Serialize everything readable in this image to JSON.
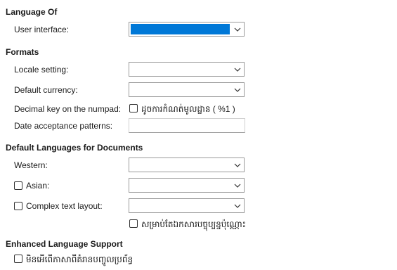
{
  "sections": {
    "language_of": "Language Of",
    "formats": "Formats",
    "default_languages": "Default Languages for Documents",
    "enhanced_support": "Enhanced Language Support"
  },
  "language_of": {
    "user_interface_label": "User interface:",
    "user_interface_value": ""
  },
  "formats": {
    "locale_label": "Locale setting:",
    "locale_value": "",
    "currency_label": "Default currency:",
    "currency_value": "",
    "decimal_key_label": "Decimal key on the numpad:",
    "decimal_key_checkbox_label": "ដូចការកំណត់មូលដ្ឋាន ( %1 )",
    "decimal_key_checked": false,
    "date_patterns_label": "Date acceptance patterns:",
    "date_patterns_value": ""
  },
  "default_languages": {
    "western_label": "Western:",
    "western_value": "",
    "asian_label": "Asian:",
    "asian_checked": false,
    "asian_value": "",
    "ctl_label": "Complex text layout:",
    "ctl_checked": false,
    "ctl_value": "",
    "current_doc_label": "សម្រាប់តែឯកសារបច្ចុប្បន្នប៉ុណ្ណោះ",
    "current_doc_checked": false
  },
  "enhanced_support": {
    "ignore_system_input_label": "មិនអើពើភាសាពីគំរានបញ្ចូលប្រព័ន្ធ",
    "ignore_system_input_checked": false
  },
  "colors": {
    "selection_highlight": "#0078d7",
    "border": "#9a9a9a"
  }
}
